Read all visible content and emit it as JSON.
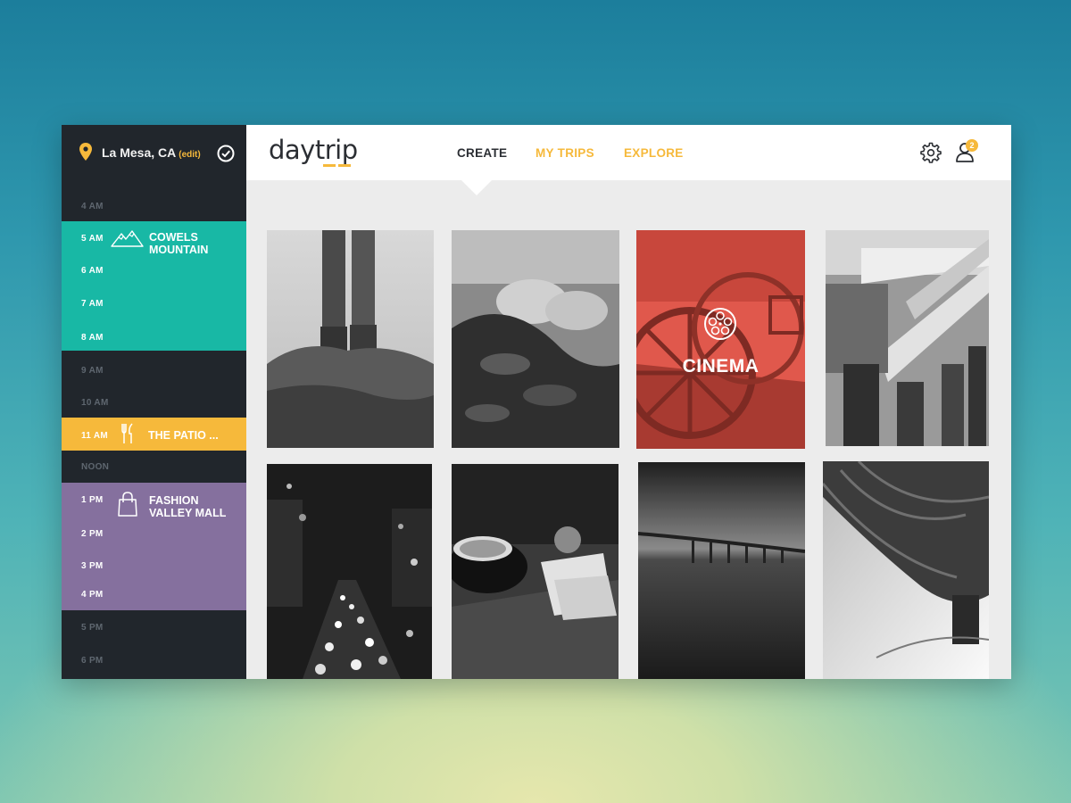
{
  "location": {
    "city": "La Mesa, CA",
    "edit_label": "(edit)"
  },
  "schedule": {
    "hours": [
      "4 AM",
      "5 AM",
      "6 AM",
      "7 AM",
      "8 AM",
      "9 AM",
      "10 AM",
      "11 AM",
      "NOON",
      "1 PM",
      "2 PM",
      "3 PM",
      "4 PM",
      "5 PM",
      "6 PM"
    ],
    "events": [
      {
        "line1": "COWELS",
        "line2": "MOUNTAIN",
        "color": "#18b8a5",
        "icon": "mountain-icon"
      },
      {
        "line1": "THE PATIO ...",
        "color": "#f6b93b",
        "icon": "fork-knife-icon"
      },
      {
        "line1": "FASHION",
        "line2": "VALLEY MALL",
        "color": "#85709e",
        "icon": "shopping-bag-icon"
      }
    ]
  },
  "header": {
    "logo": "daytrip",
    "nav": [
      "CREATE",
      "MY TRIPS",
      "EXPLORE"
    ],
    "active_tab": "CREATE",
    "notification_count": "2"
  },
  "colors": {
    "accent": "#f6b93b",
    "teal": "#18b8a5",
    "purple": "#85709e",
    "cinema": "#e0584c",
    "sidebar": "#21262c"
  },
  "tiles": [
    {
      "name": "hiker-boots"
    },
    {
      "name": "pastries"
    },
    {
      "name": "cinema",
      "label": "CINEMA",
      "icon": "film-reel-icon"
    },
    {
      "name": "escalator-crowd"
    },
    {
      "name": "city-night-traffic"
    },
    {
      "name": "coffee-cafe"
    },
    {
      "name": "bridge-bay"
    },
    {
      "name": "hot-air-balloon"
    }
  ]
}
